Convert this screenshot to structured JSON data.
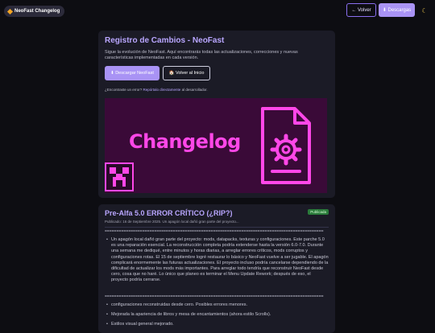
{
  "header": {
    "brand": "NeoFast Changelog",
    "back_label": "← Volver",
    "download_label": "⬇ Descargas",
    "theme_icon": "moon-icon"
  },
  "intro": {
    "title": "Registro de Cambios - NeoFast",
    "description": "Sigue la evolución de NeoFast. Aquí encontrarás todas las actualizaciones, correcciones y nuevas características implementadas en cada versión.",
    "download_button": "⬇ Descargar NeoFast",
    "home_button": "🏠 Volver al Inicio",
    "report_prefix": "¿Encontraste un error? ",
    "report_link": "Repórtalo directamente",
    "report_suffix": " al desarrollador.",
    "banner_text": "Changelog"
  },
  "entry": {
    "title": "Pre-Alfa 5.0 ERROR CRÍTICO (¿RIP?)",
    "badge": "Publicada",
    "meta": "Publicado: 16 de Septiembre 2025. Un apagón local dañó gran parte del proyecto...",
    "separator": "=============================================================================================",
    "bullet1": "Un apagón local dañó gran parte del proyecto: mods, datapacks, texturas y configuraciones. Este parche 5.0 es una reparación esencial. La reconstrucción completa podría extenderse hasta la versión 6.0-7.0. Durante una semana me dediqué, entre minutos y horas diarias, a arreglar errores críticos, mods corruptos y configuraciones rotas. El 15 de septiembre logré restaurar lo básico y NeoFast vuelve a ser jugable. El apagón complicará enormemente las futuras actualizaciones. El proyecto incluso podría cancelarse dependiendo de la dificultad de actualizar los mods más importantes. Para arreglar todo tendría que reconstruir NeoFast desde cero, cosa que no haré. Lo único que planeo es terminar el Menu Update Rework; después de eso, el proyecto podría cerrarse.",
    "bullet2": "configuraciones reconstruidas desde cero. Posibles errores menores.",
    "bullet3": "Mejorada la apariencia de libros y mesa de encantamientos (ahora estilo Scrolls).",
    "bullet4": "Estilos visual general mejorado."
  }
}
